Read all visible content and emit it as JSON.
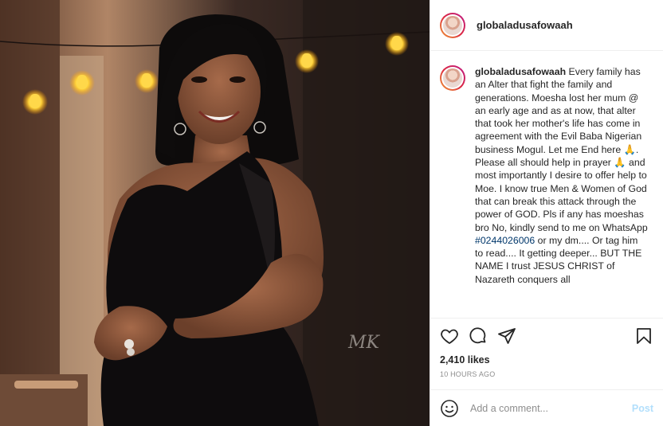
{
  "post": {
    "username": "globaladusafowaah",
    "caption": {
      "username": "globaladusafowaah",
      "text_before_tag": "Every family has an Alter that fight the family and generations. Moesha lost her mum @ an early age and as at now, that alter that took her mother's life has come in agreement with the Evil Baba Nigerian business Mogul. Let me End here 🙏. Please all should help in prayer 🙏 and most importantly I desire to offer help to Moe. I know true Men & Women of God that can break this attack through the power of GOD. Pls if any has moeshas bro No, kindly send to me on WhatsApp",
      "hashtag": "#0244026006",
      "text_after_tag": "or my dm.... Or tag him to read.... It getting deeper... BUT THE NAME I trust JESUS CHRIST of Nazareth conquers all"
    },
    "likes": "2,410 likes",
    "timestamp": "10 HOURS AGO",
    "comment_placeholder": "Add a comment...",
    "post_label": "Post",
    "photo_watermark": "MK"
  },
  "icons": {
    "like": "heart-icon",
    "comment": "comment-icon",
    "share": "share-icon",
    "save": "bookmark-icon",
    "emoji": "emoji-icon"
  },
  "colors": {
    "link": "#00376b",
    "post_button": "#b2dffc",
    "muted": "#8e8e8e",
    "border": "#efefef"
  }
}
